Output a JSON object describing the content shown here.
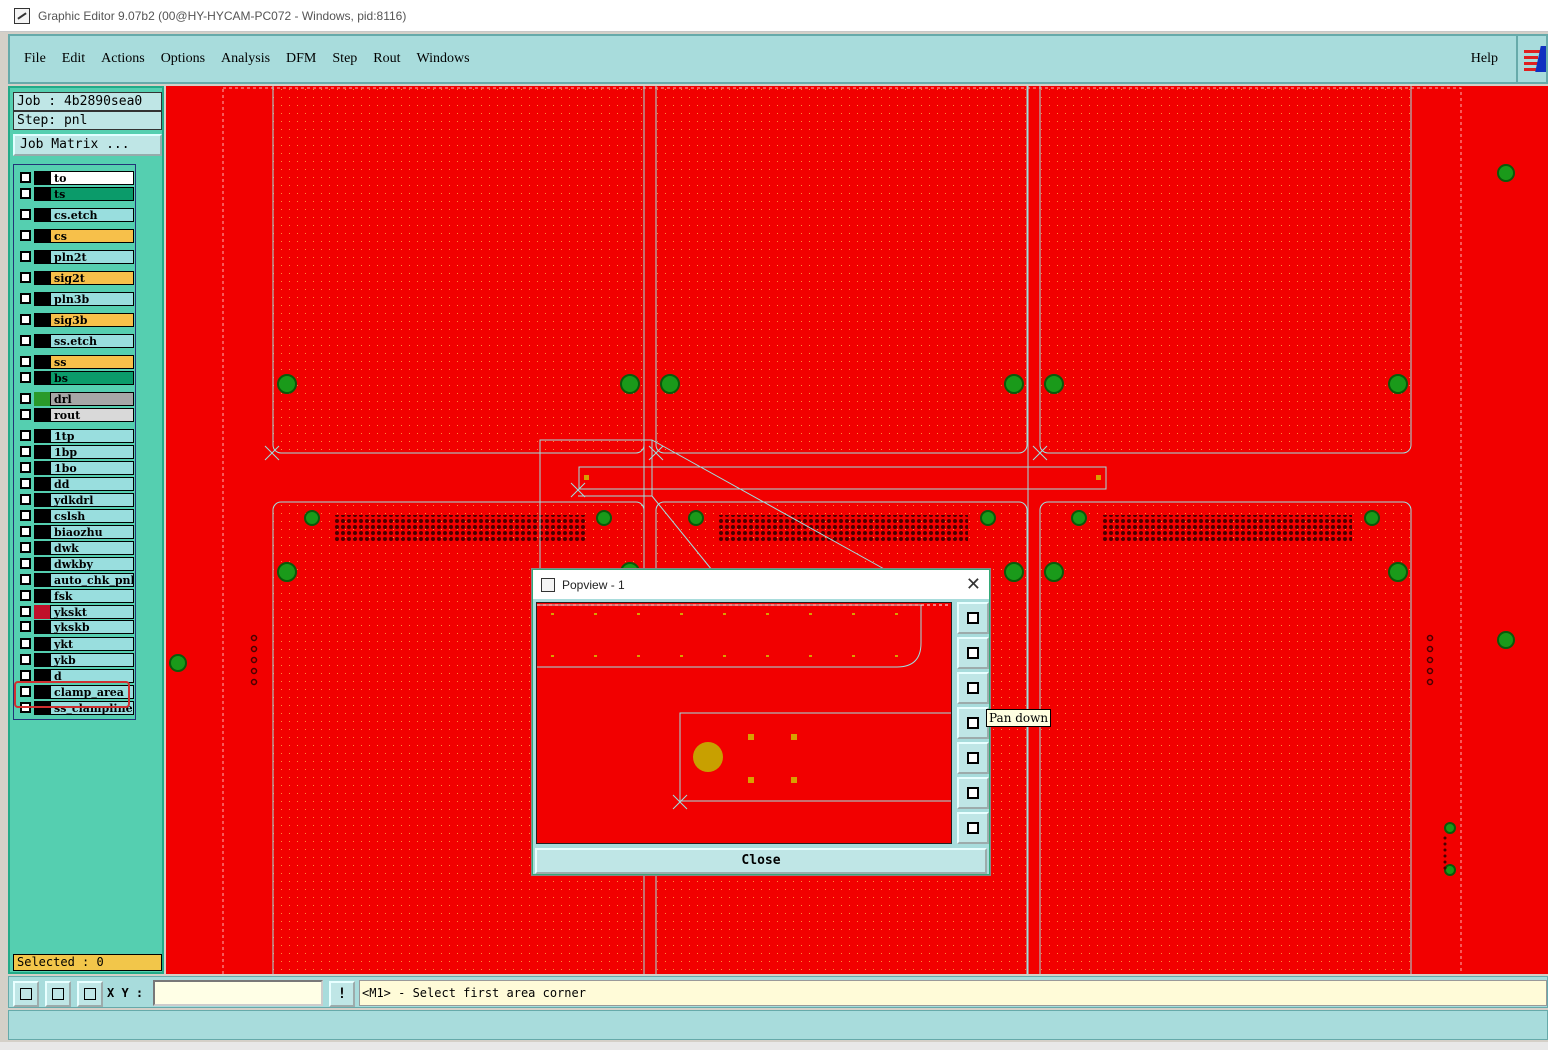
{
  "window": {
    "title": "Graphic Editor 9.07b2 (00@HY-HYCAM-PC072 - Windows, pid:8116)"
  },
  "menu": {
    "items": [
      "File",
      "Edit",
      "Actions",
      "Options",
      "Analysis",
      "DFM",
      "Step",
      "Rout",
      "Windows"
    ],
    "help": "Help"
  },
  "job": {
    "label": "Job : 4b2890sea0",
    "step": "Step: pnl",
    "matrix_button": "Job Matrix ..."
  },
  "layers": [
    {
      "name": "to",
      "color": "#ffffff"
    },
    {
      "name": "ts",
      "color": "#0b9b6a"
    },
    {
      "name": "cs.etch",
      "color": "#99dede"
    },
    {
      "name": "cs",
      "color": "#f7c04a"
    },
    {
      "name": "pln2t",
      "color": "#99dede"
    },
    {
      "name": "sig2t",
      "color": "#f7c04a"
    },
    {
      "name": "pln3b",
      "color": "#99dede"
    },
    {
      "name": "sig3b",
      "color": "#f7c04a"
    },
    {
      "name": "ss.etch",
      "color": "#99dede"
    },
    {
      "name": "ss",
      "color": "#f7c04a"
    },
    {
      "name": "bs",
      "color": "#0b9b6a"
    },
    {
      "name": "drl",
      "color": "#a7a7a7"
    },
    {
      "name": "rout",
      "color": "#d9d9d9"
    },
    {
      "name": "1tp",
      "color": "#99dede"
    },
    {
      "name": "1bp",
      "color": "#99dede"
    },
    {
      "name": "1bo",
      "color": "#99dede"
    },
    {
      "name": "dd",
      "color": "#99dede"
    },
    {
      "name": "ydkdrl",
      "color": "#99dede"
    },
    {
      "name": "cslsh",
      "color": "#99dede"
    },
    {
      "name": "biaozhu",
      "color": "#99dede"
    },
    {
      "name": "dwk",
      "color": "#99dede"
    },
    {
      "name": "dwkby",
      "color": "#99dede"
    },
    {
      "name": "auto_chk_pnl",
      "color": "#99dede"
    },
    {
      "name": "fsk",
      "color": "#99dede"
    },
    {
      "name": "ykskt",
      "color": "#99dede"
    },
    {
      "name": "ykskb",
      "color": "#99dede"
    },
    {
      "name": "ykt",
      "color": "#99dede"
    },
    {
      "name": "ykb",
      "color": "#99dede"
    },
    {
      "name": "d",
      "color": "#99dede"
    },
    {
      "name": "clamp_area",
      "color": "#99dede"
    },
    {
      "name": "ss_clampline",
      "color": "#99dede"
    }
  ],
  "selected": "Selected : 0",
  "popview": {
    "title": "Popview - 1",
    "close_label": "Close",
    "tooltip": "Pan down",
    "tools": [
      "zoom-window-icon",
      "pan-up-icon",
      "pan-down-icon",
      "pan-left-icon",
      "pan-right-icon",
      "zoom-fit-icon",
      "zoom-home-icon"
    ]
  },
  "status": {
    "xy_label": "X Y :",
    "xy_value": "",
    "message": "<M1> - Select first area corner"
  },
  "colors": {
    "canvas": "#f20000",
    "panel": "#55cfb0",
    "menubar": "#a8dcdc",
    "pad": "#1a9a1a"
  }
}
